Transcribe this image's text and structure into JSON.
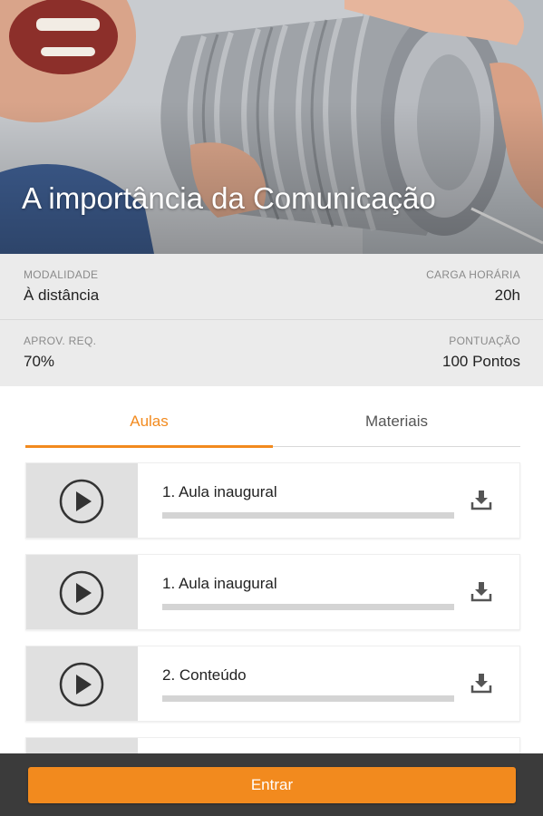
{
  "course": {
    "title": "A importância da Comunicação"
  },
  "info": {
    "modalidade_label": "MODALIDADE",
    "modalidade_value": "À distância",
    "carga_label": "CARGA HORÁRIA",
    "carga_value": "20h",
    "aprov_label": "APROV. REQ.",
    "aprov_value": "70%",
    "pontuacao_label": "PONTUAÇÃO",
    "pontuacao_value": "100 Pontos"
  },
  "tabs": [
    {
      "label": "Aulas",
      "selected": true
    },
    {
      "label": "Materiais",
      "selected": false
    }
  ],
  "lessons": [
    {
      "title": "1. Aula inaugural",
      "icon": "play-icon",
      "action_icon": "download-icon"
    },
    {
      "title": "1. Aula inaugural",
      "icon": "play-icon",
      "action_icon": "download-icon"
    },
    {
      "title": "2. Conteúdo",
      "icon": "play-icon",
      "action_icon": "download-icon"
    }
  ],
  "footer": {
    "enter_label": "Entrar"
  },
  "colors": {
    "accent": "#f28a1e",
    "footer_bg": "#3b3b3b",
    "info_bg": "#ebebeb"
  }
}
